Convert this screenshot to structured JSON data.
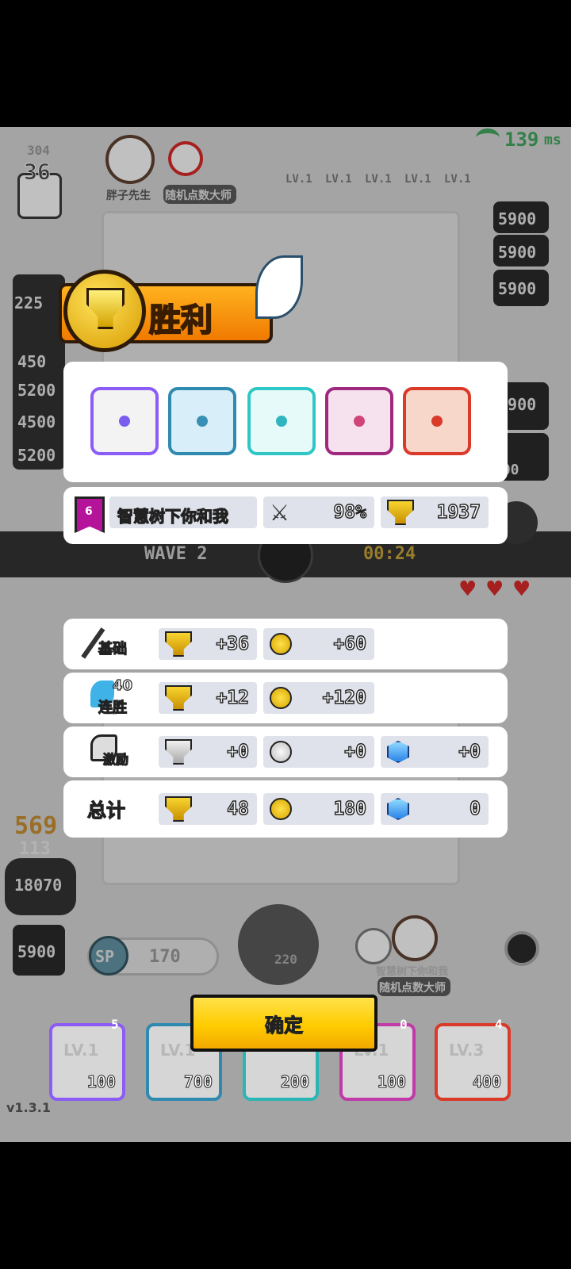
{
  "background": {
    "top_left_counter": "36",
    "top_left_sub": "304",
    "player_top_name": "胖子先生",
    "player_top_title": "随机点数大师",
    "signal_ping": "139",
    "signal_unit": "ms",
    "dice_levels": [
      "LV.1",
      "LV.1",
      "LV.1",
      "LV.1",
      "LV.1"
    ],
    "right_hp_values": [
      "5900",
      "5900",
      "5900",
      "5900",
      "900"
    ],
    "left_hp_values": [
      "225",
      "450",
      "5200",
      "4500",
      "5200"
    ],
    "wave_label": "WAVE 2",
    "wave_timer": "00:24",
    "bottom_score": "569",
    "bottom_score_sub": "113",
    "bottom_left_hp": "18070",
    "bottom_left_box": "5900",
    "sp_label": "SP",
    "sp_value": "170",
    "summon_cost": "220",
    "opponent_name": "智慧树下你和我",
    "opponent_title": "随机点数大师",
    "deck": [
      {
        "level": "LV.1",
        "cost": "100",
        "badge": "5",
        "color": "#8b5cf6"
      },
      {
        "level": "LV.1",
        "cost": "700",
        "badge": "",
        "color": "#2f8ab0"
      },
      {
        "level": "",
        "cost": "200",
        "badge": "",
        "color": "#2bb5b5"
      },
      {
        "level": "LV.1",
        "cost": "100",
        "badge": "0",
        "color": "#c03aa8"
      },
      {
        "level": "LV.3",
        "cost": "400",
        "badge": "4",
        "color": "#d93a2a"
      }
    ],
    "version": "v1.3.1"
  },
  "victory": {
    "title": "胜利",
    "dice": [
      {
        "name": "rainbow-dice",
        "border": "#8b5cf6",
        "dot": "#7a5cf0"
      },
      {
        "name": "whirlwind-dice",
        "border": "#2f8ab0",
        "dot": "#3a8fb5"
      },
      {
        "name": "ice-dice",
        "border": "#2fc6c6",
        "dot": "#2fb5c0"
      },
      {
        "name": "lightning-dice",
        "border": "#a0287e",
        "dot": "#d0447a"
      },
      {
        "name": "fire-dice",
        "border": "#d93a2a",
        "dot": "#d93a2a"
      }
    ],
    "player": {
      "rank": "6",
      "name": "智慧树下你和我",
      "win_rate": "98%",
      "trophies": "1937"
    }
  },
  "rewards": [
    {
      "label": "基础",
      "trophy": "+36",
      "coin": "+60",
      "gem": null
    },
    {
      "label": "连胜",
      "streak": "40",
      "trophy": "+12",
      "coin": "+120",
      "gem": null
    },
    {
      "label": "激励",
      "trophy": "+0",
      "coin": "+0",
      "gem": "+0"
    }
  ],
  "total": {
    "label": "总计",
    "trophy": "48",
    "coin": "180",
    "gem": "0"
  },
  "confirm_label": "确定"
}
